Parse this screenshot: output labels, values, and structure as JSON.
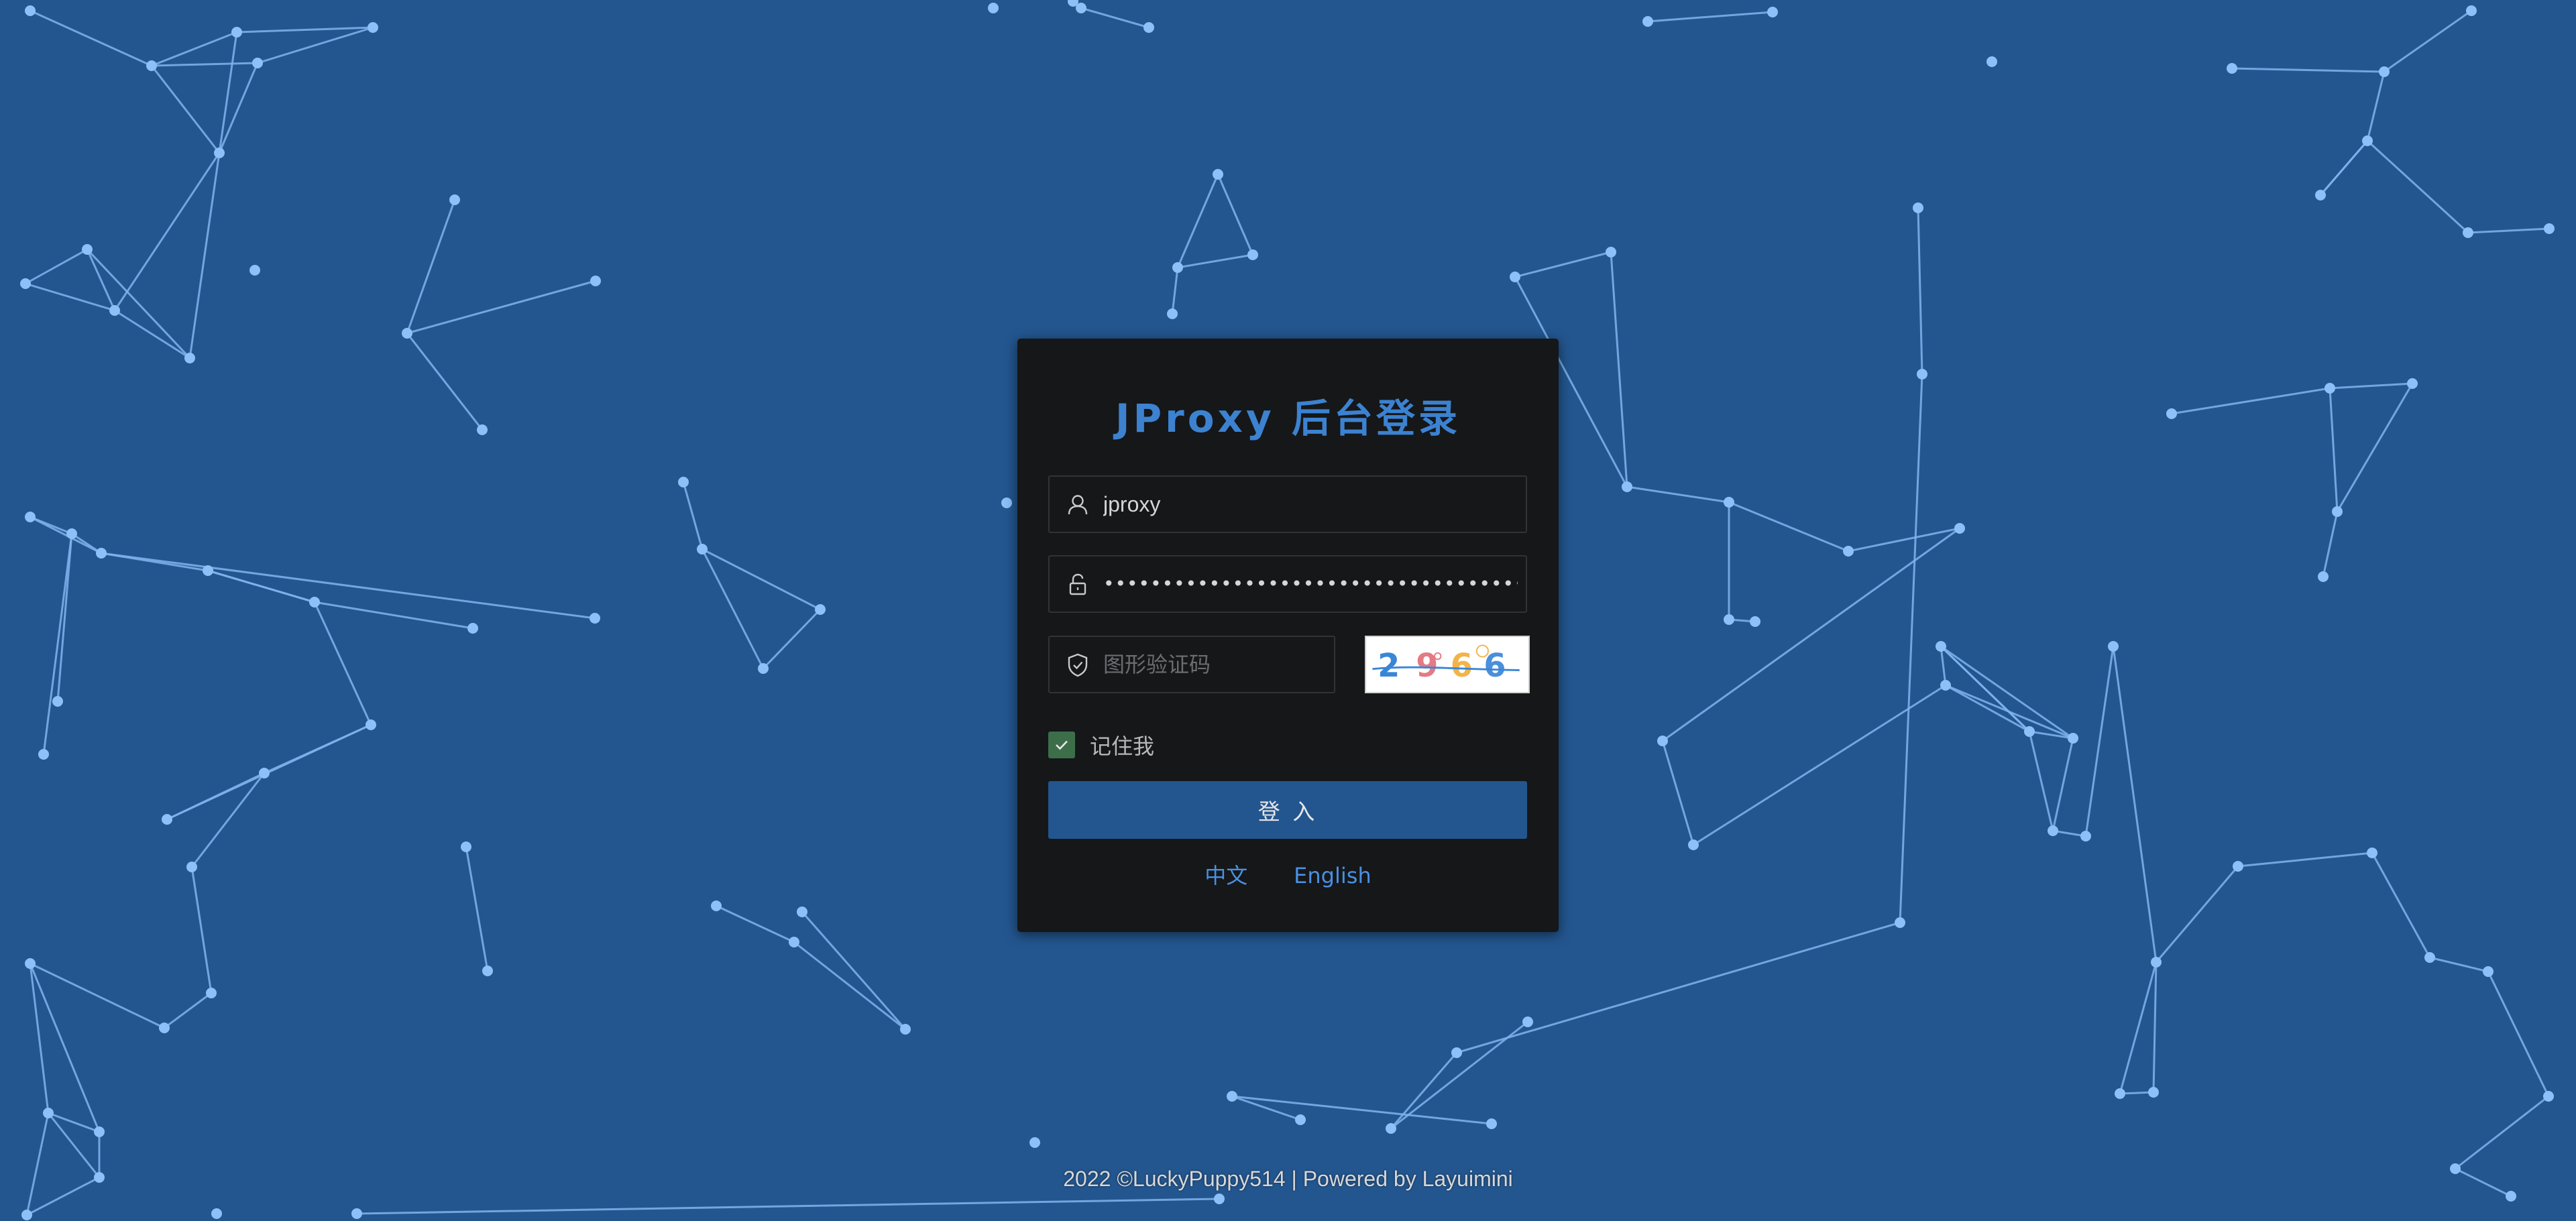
{
  "colors": {
    "background": "#23568f",
    "network_line": "#80b4ef",
    "network_node": "#8cc0f6",
    "card": "#151719",
    "title": "#3c82d0",
    "button": "#23568f",
    "checkbox": "#3d6e4a",
    "link": "#4a90e2"
  },
  "login": {
    "title": "JProxy 后台登录",
    "username": {
      "value": "jproxy",
      "icon": "user-icon"
    },
    "password": {
      "value": "••••••••••••••••••••••••••••••••••••••••••••••",
      "icon": "lock-icon"
    },
    "captcha": {
      "placeholder": "图形验证码",
      "icon": "shield-check-icon",
      "image_text": "2966"
    },
    "remember_me": {
      "label": "记住我",
      "checked": true,
      "icon": "check-icon"
    },
    "submit_label": "登 入",
    "languages": [
      "中文",
      "English"
    ]
  },
  "footer": {
    "text": "2022 ©LuckyPuppy514 | Powered by Layuimini"
  }
}
